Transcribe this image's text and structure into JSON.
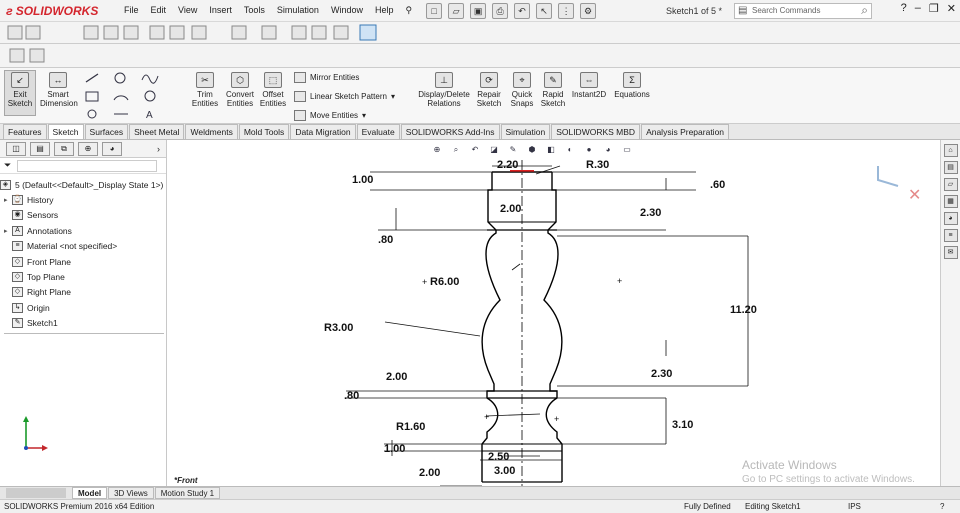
{
  "app": {
    "logo_text": "SOLIDWORKS",
    "menu": [
      "File",
      "Edit",
      "View",
      "Insert",
      "Tools",
      "Simulation",
      "Window",
      "Help"
    ],
    "doc_title": "Sketch1 of 5 *",
    "search_placeholder": "Search Commands"
  },
  "ribbon": {
    "exit_sketch": "Exit Sketch",
    "smart_dimension": "Smart Dimension",
    "trim_entities": "Trim Entities",
    "convert_entities": "Convert Entities",
    "offset_entities": "Offset Entities",
    "mirror_entities": "Mirror Entities",
    "linear_sketch_pattern": "Linear Sketch Pattern",
    "move_entities": "Move Entities",
    "display_delete_relations": "Display/Delete Relations",
    "repair_sketch": "Repair Sketch",
    "quick_snaps": "Quick Snaps",
    "rapid_sketch": "Rapid Sketch",
    "instant2d": "Instant2D",
    "equations": "Equations"
  },
  "tabs": [
    "Features",
    "Sketch",
    "Surfaces",
    "Sheet Metal",
    "Weldments",
    "Mold Tools",
    "Data Migration",
    "Evaluate",
    "SOLIDWORKS Add-Ins",
    "Simulation",
    "SOLIDWORKS MBD",
    "Analysis Preparation"
  ],
  "active_tab": "Sketch",
  "tree": {
    "root": "5  (Default<<Default>_Display State 1>)",
    "items": [
      "History",
      "Sensors",
      "Annotations",
      "Material <not specified>",
      "Front Plane",
      "Top Plane",
      "Right Plane",
      "Origin",
      "Sketch1"
    ]
  },
  "drawing": {
    "dimensions": [
      "2.20",
      "R.30",
      "1.00",
      ".60",
      "2.00",
      "2.30",
      ".80",
      "R6.00",
      "11.20",
      "R3.00",
      "2.00",
      "2.30",
      ".80",
      "R1.60",
      "3.10",
      "1.00",
      "2.50",
      "3.00",
      "2.00"
    ],
    "view_label": "*Front"
  },
  "bottom_tabs": [
    "Model",
    "3D Views",
    "Motion Study 1"
  ],
  "status": {
    "edition": "SOLIDWORKS Premium 2016 x64 Edition",
    "defined": "Fully Defined",
    "editing": "Editing Sketch1",
    "units": "IPS"
  },
  "watermark": {
    "line1": "Activate Windows",
    "line2": "Go to PC settings to activate Windows."
  }
}
